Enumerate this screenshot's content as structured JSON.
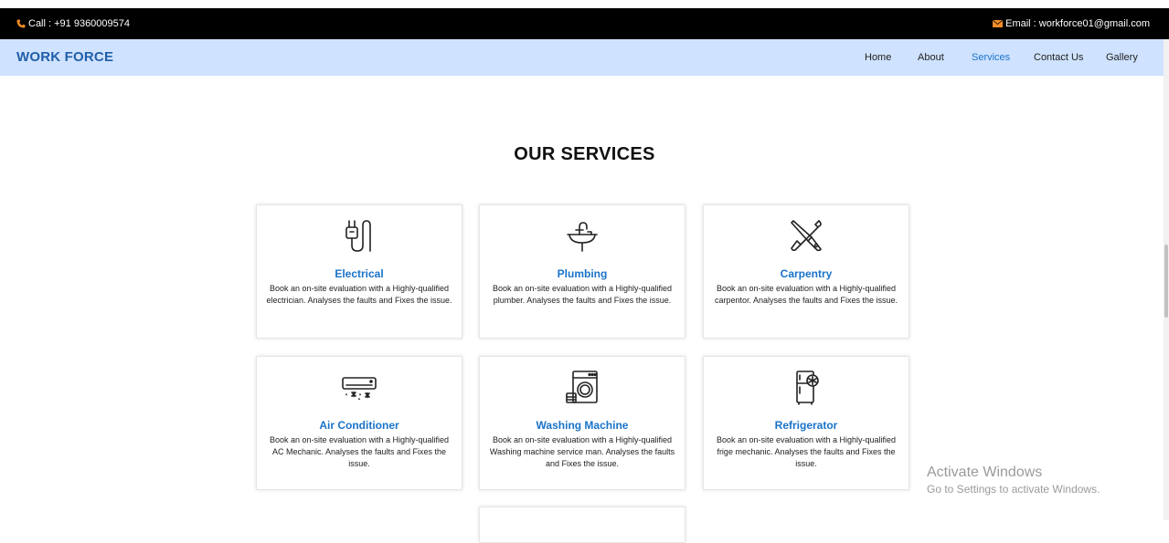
{
  "topbar": {
    "call": "Call : +91 9360009574",
    "email": "Email : workforce01@gmail.com"
  },
  "navbar": {
    "brand": "WORK FORCE",
    "links": [
      "Home",
      "About",
      "Services",
      "Contact Us",
      "Gallery"
    ],
    "active": "Services"
  },
  "services": {
    "title": "OUR SERVICES",
    "cards": [
      {
        "icon": "plug-icon",
        "title": "Electrical",
        "desc": "Book an on-site evaluation with a Highly-qualified electrician. Analyses the faults and Fixes the issue."
      },
      {
        "icon": "sink-icon",
        "title": "Plumbing",
        "desc": "Book an on-site evaluation with a Highly-qualified plumber. Analyses the faults and Fixes the issue."
      },
      {
        "icon": "tools-icon",
        "title": "Carpentry",
        "desc": "Book an on-site evaluation with a Highly-qualified carpentor. Analyses the faults and Fixes the issue."
      },
      {
        "icon": "air-conditioner-icon",
        "title": "Air Conditioner",
        "desc": "Book an on-site evaluation with a Highly-qualified AC Mechanic. Analyses the faults and Fixes the issue."
      },
      {
        "icon": "washing-machine-icon",
        "title": "Washing Machine",
        "desc": "Book an on-site evaluation with a Highly-qualified Washing machine service man. Analyses the faults and Fixes the issue."
      },
      {
        "icon": "refrigerator-icon",
        "title": "Refrigerator",
        "desc": "Book an on-site evaluation with a Highly-qualified frige mechanic. Analyses the faults and Fixes the issue."
      }
    ]
  },
  "watermark": {
    "line1": "Activate Windows",
    "line2": "Go to Settings to activate Windows."
  },
  "colors": {
    "accent": "#1a73c9",
    "brand": "#1f5fa8",
    "navbar_bg": "#cfe2ff",
    "topbar_bg": "#000000",
    "phone_icon": "#f28c28",
    "mail_icon": "#f28c28"
  }
}
